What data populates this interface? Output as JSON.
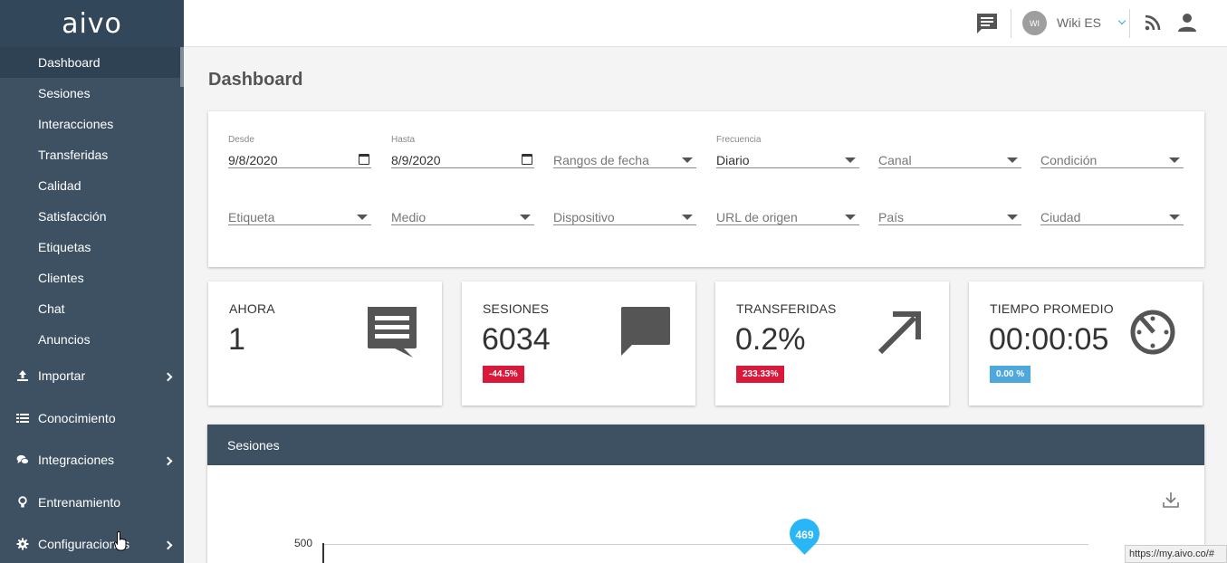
{
  "brand": {
    "logo": "aivo"
  },
  "sidebar": {
    "items": [
      {
        "label": "Dashboard",
        "active": true
      },
      {
        "label": "Sesiones"
      },
      {
        "label": "Interacciones"
      },
      {
        "label": "Transferidas"
      },
      {
        "label": "Calidad"
      },
      {
        "label": "Satisfacción"
      },
      {
        "label": "Etiquetas"
      },
      {
        "label": "Clientes"
      },
      {
        "label": "Chat"
      },
      {
        "label": "Anuncios"
      }
    ],
    "sections": [
      {
        "label": "Importar",
        "icon": "upload-icon",
        "expandable": true
      },
      {
        "label": "Conocimiento",
        "icon": "list-icon",
        "expandable": false
      },
      {
        "label": "Integraciones",
        "icon": "chat-bubbles-icon",
        "expandable": true
      },
      {
        "label": "Entrenamiento",
        "icon": "lightbulb-icon",
        "expandable": false
      },
      {
        "label": "Configuraciones",
        "icon": "gear-icon",
        "expandable": true
      }
    ]
  },
  "topbar": {
    "avatar_initials": "WI",
    "user_label": "Wiki ES"
  },
  "page": {
    "title": "Dashboard"
  },
  "filters": {
    "desde": {
      "label": "Desde",
      "value": "9/8/2020"
    },
    "hasta": {
      "label": "Hasta",
      "value": "8/9/2020"
    },
    "rangos": {
      "placeholder": "Rangos de fecha"
    },
    "frecuencia": {
      "label": "Frecuencia",
      "value": "Diario"
    },
    "canal": {
      "placeholder": "Canal"
    },
    "condicion": {
      "placeholder": "Condición"
    },
    "etiqueta": {
      "placeholder": "Etiqueta"
    },
    "medio": {
      "placeholder": "Medio"
    },
    "dispositivo": {
      "placeholder": "Dispositivo"
    },
    "url_origen": {
      "placeholder": "URL de origen"
    },
    "pais": {
      "placeholder": "País"
    },
    "ciudad": {
      "placeholder": "Ciudad"
    }
  },
  "stats": [
    {
      "label": "AHORA",
      "value": "1",
      "icon": "message-icon"
    },
    {
      "label": "SESIONES",
      "value": "6034",
      "badge": "-44.5%",
      "badge_color": "#d9183b",
      "icon": "chat-bubble-icon"
    },
    {
      "label": "TRANSFERIDAS",
      "value": "0.2%",
      "badge": "233.33%",
      "badge_color": "#d9183b",
      "icon": "arrow-up-right-icon"
    },
    {
      "label": "TIEMPO PROMEDIO",
      "value": "00:00:05",
      "badge": "0.00 %",
      "badge_color": "#4ea7dd",
      "icon": "timer-icon"
    }
  ],
  "sessions_chart": {
    "title": "Sesiones",
    "y_tick": "500",
    "peak_label": "469"
  },
  "chart_data": {
    "type": "line",
    "title": "Sesiones",
    "y_ticks": [
      500
    ],
    "annotations": [
      {
        "label": "469",
        "value": 469
      }
    ]
  },
  "status_bar": {
    "url": "https://my.aivo.co/#"
  },
  "colors": {
    "sidebar": "#3d5163",
    "accent": "#29b6f6",
    "negative": "#d9183b",
    "neutral_badge": "#4ea7dd"
  }
}
